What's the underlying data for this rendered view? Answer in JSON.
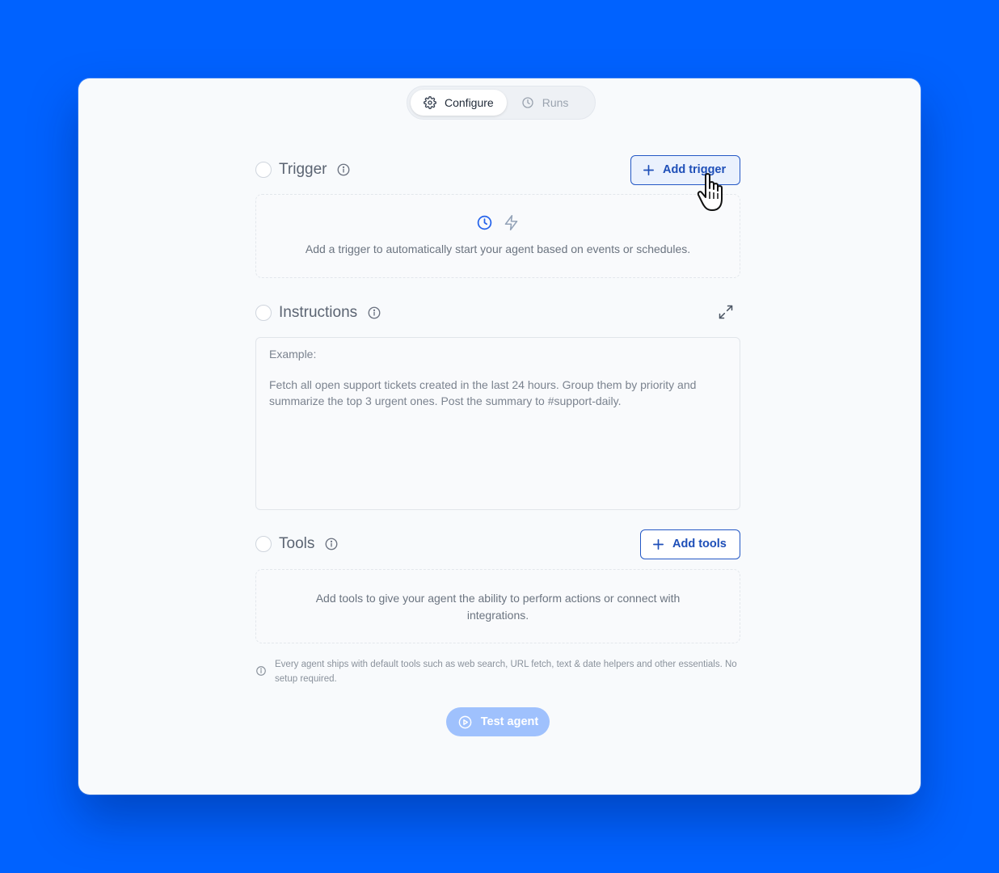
{
  "tabs": {
    "configure": {
      "label": "Configure",
      "icon": "gear-icon",
      "active": true
    },
    "runs": {
      "label": "Runs",
      "icon": "clock-icon",
      "active": false
    }
  },
  "trigger": {
    "title": "Trigger",
    "add_label": "Add trigger",
    "empty_text": "Add a trigger to automatically start your agent based on events or schedules.",
    "icons": [
      "clock-icon",
      "lightning-icon"
    ]
  },
  "instructions": {
    "title": "Instructions",
    "placeholder_label": "Example:",
    "placeholder_body": "Fetch all open support tickets created in the last 24 hours. Group them by priority and summarize the top 3 urgent ones. Post the summary to #support-daily."
  },
  "tools": {
    "title": "Tools",
    "add_label": "Add tools",
    "empty_text": "Add tools to give your agent the ability to perform actions or connect with integrations."
  },
  "note": "Every agent ships with default tools such as web search, URL fetch, text & date helpers and other essentials. No setup required.",
  "test_button": {
    "label": "Test agent",
    "disabled": true
  },
  "colors": {
    "background": "#0062ff",
    "accent": "#1e4fb8",
    "test_button": "#9fc1fd"
  }
}
